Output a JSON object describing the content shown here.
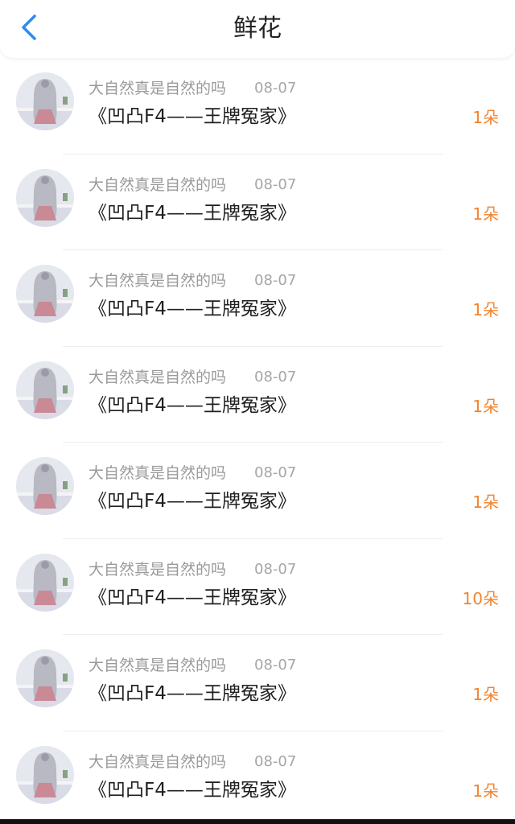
{
  "header": {
    "title": "鲜花",
    "back_icon": "chevron-left-icon",
    "accent_color": "#2d8cf0"
  },
  "items": [
    {
      "user": "大自然真是自然的吗",
      "date": "08-07",
      "work": "《凹凸F4——王牌冤家》",
      "count": "1朵"
    },
    {
      "user": "大自然真是自然的吗",
      "date": "08-07",
      "work": "《凹凸F4——王牌冤家》",
      "count": "1朵"
    },
    {
      "user": "大自然真是自然的吗",
      "date": "08-07",
      "work": "《凹凸F4——王牌冤家》",
      "count": "1朵"
    },
    {
      "user": "大自然真是自然的吗",
      "date": "08-07",
      "work": "《凹凸F4——王牌冤家》",
      "count": "1朵"
    },
    {
      "user": "大自然真是自然的吗",
      "date": "08-07",
      "work": "《凹凸F4——王牌冤家》",
      "count": "1朵"
    },
    {
      "user": "大自然真是自然的吗",
      "date": "08-07",
      "work": "《凹凸F4——王牌冤家》",
      "count": "10朵"
    },
    {
      "user": "大自然真是自然的吗",
      "date": "08-07",
      "work": "《凹凸F4——王牌冤家》",
      "count": "1朵"
    },
    {
      "user": "大自然真是自然的吗",
      "date": "08-07",
      "work": "《凹凸F4——王牌冤家》",
      "count": "1朵"
    }
  ],
  "colors": {
    "count": "#f2842f",
    "name": "#9a9a9a",
    "title": "#1f1f1f"
  }
}
